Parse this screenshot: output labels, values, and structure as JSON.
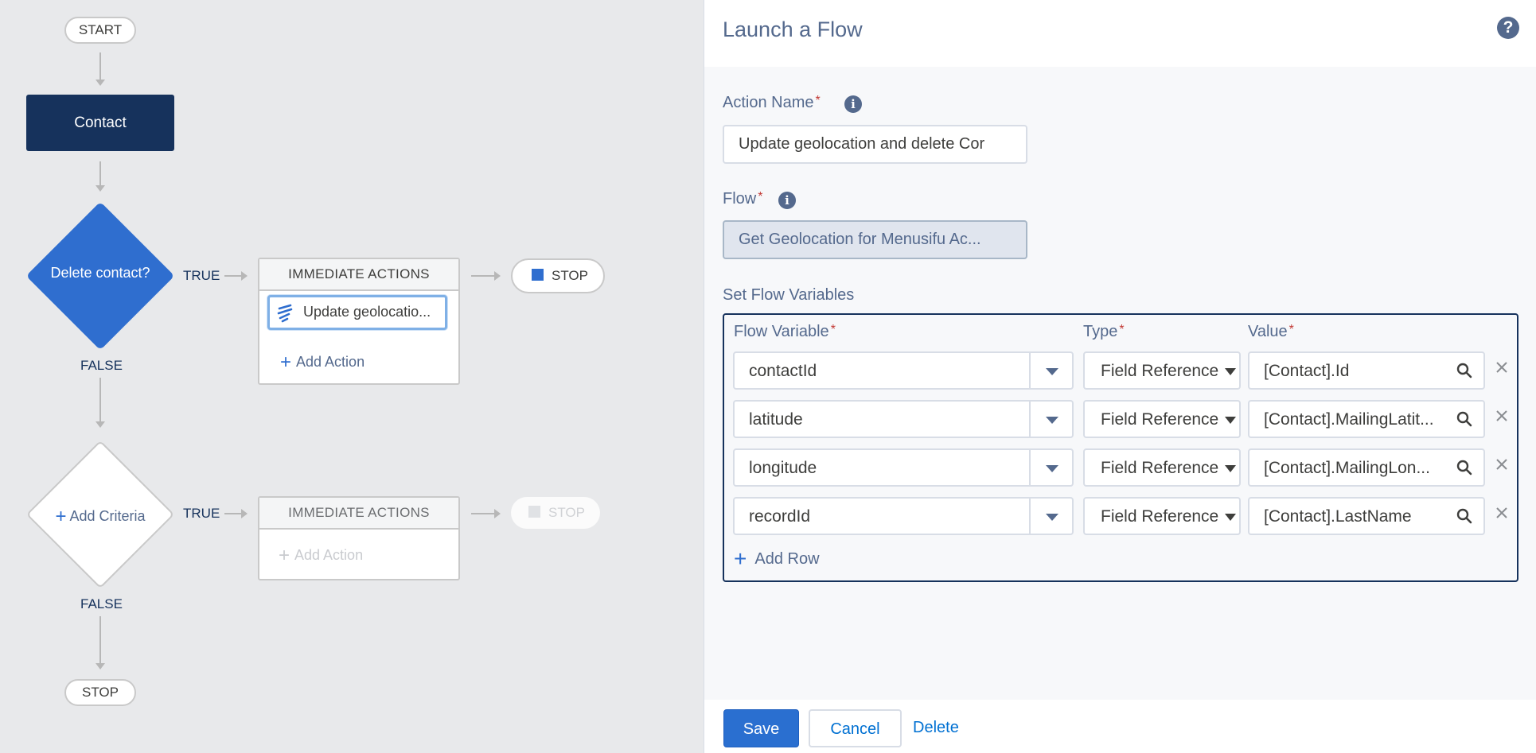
{
  "canvas": {
    "start_label": "START",
    "object_label": "Contact",
    "criteria1_label": "Delete contact?",
    "criteria2_label": "Add Criteria",
    "true_label": "TRUE",
    "false_label": "FALSE",
    "immediate_actions_label": "IMMEDIATE ACTIONS",
    "action_item_label": "Update geolocatio...",
    "add_action_label": "Add Action",
    "stop_label": "STOP"
  },
  "panel": {
    "title": "Launch a Flow",
    "action_name_label": "Action Name",
    "action_name_value": "Update geolocation and delete Cor",
    "flow_label": "Flow",
    "flow_value": "Get Geolocation for Menusifu Ac...",
    "set_vars_label": "Set Flow Variables",
    "col_flow_variable": "Flow Variable",
    "col_type": "Type",
    "col_value": "Value",
    "rows": [
      {
        "variable": "contactId",
        "type": "Field Reference",
        "value": "[Contact].Id"
      },
      {
        "variable": "latitude",
        "type": "Field Reference",
        "value": "[Contact].MailingLatit..."
      },
      {
        "variable": "longitude",
        "type": "Field Reference",
        "value": "[Contact].MailingLon..."
      },
      {
        "variable": "recordId",
        "type": "Field Reference",
        "value": "[Contact].LastName"
      }
    ],
    "add_row_label": "Add Row",
    "save_label": "Save",
    "cancel_label": "Cancel",
    "delete_label": "Delete"
  },
  "colors": {
    "navy": "#16325c",
    "brand_blue": "#2f6ecf",
    "link_blue": "#0070d2",
    "required": "#c23934"
  }
}
